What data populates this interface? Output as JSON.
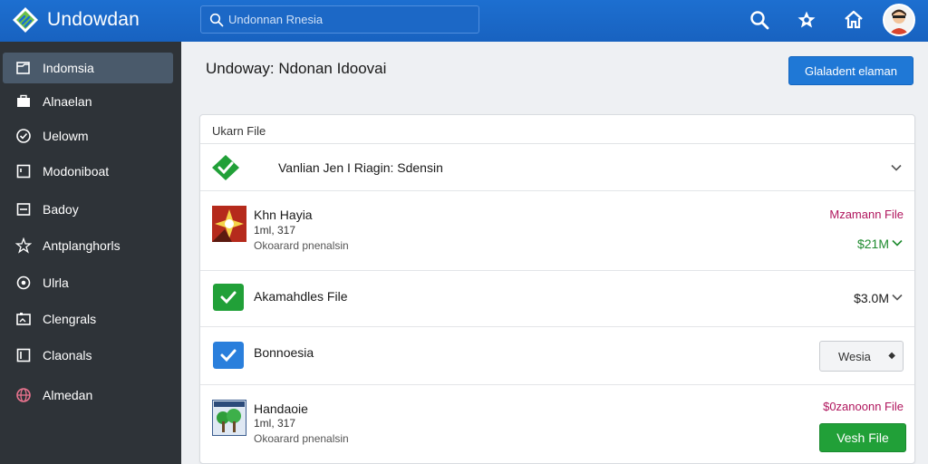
{
  "app": {
    "title": "Undowdan"
  },
  "search": {
    "placeholder": "Undonnan Rnesia"
  },
  "topbar": {
    "icons": [
      "search-icon",
      "star-icon",
      "home-icon"
    ]
  },
  "sidebar": {
    "items": [
      {
        "label": "Indomsia",
        "icon": "folder-icon",
        "active": true
      },
      {
        "label": "Alnaelan",
        "icon": "briefcase-icon"
      },
      {
        "label": "Uelowm",
        "icon": "check-circle-icon"
      },
      {
        "label": "Modoniboat",
        "icon": "window-icon"
      },
      {
        "label": "Badoy",
        "icon": "document-icon"
      },
      {
        "label": "Antplanghorls",
        "icon": "star-icon"
      },
      {
        "label": "Ulrla",
        "icon": "location-icon"
      },
      {
        "label": "Clengrals",
        "icon": "image-icon"
      },
      {
        "label": "Claonals",
        "icon": "export-icon"
      },
      {
        "label": "Almedan",
        "icon": "globe-icon"
      }
    ]
  },
  "main": {
    "title": "Undoway: Ndonan Idoovai",
    "primary_button": "Glaladent elaman",
    "card_title": "Ukarn File",
    "rows": [
      {
        "name": "Vanlian Jen I Riagin: Sdensin",
        "status": "collapsible",
        "check_color": "#21a038"
      },
      {
        "name": "Khn Hayia",
        "sub": "1ml, 317",
        "desc": "Okoarard pnenalsin",
        "type": "Mzamann File",
        "size": "$21M",
        "size_color": "#1f8b2f"
      },
      {
        "name": "Akamahdles File",
        "size": "$3.0M",
        "check_color": "#21a038"
      },
      {
        "name": "Bonnoesia",
        "button": "Wesia",
        "check_color": "#2a7fdc"
      },
      {
        "name": "Handaoie",
        "sub": "1ml, 317",
        "desc": "Okoarard pnenalsin",
        "type": "$0zanoonn File",
        "button": "Vesh File"
      }
    ]
  }
}
